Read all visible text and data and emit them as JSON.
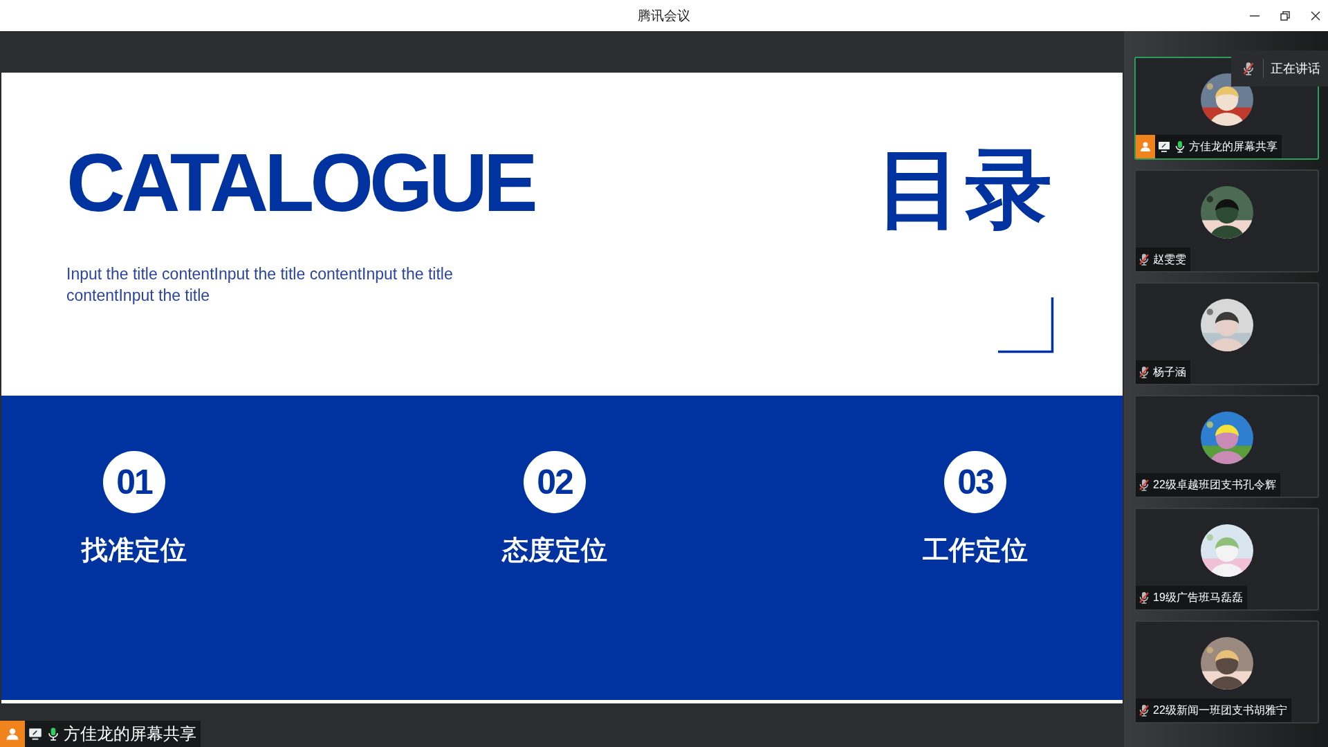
{
  "window": {
    "title": "腾讯会议"
  },
  "slide": {
    "title": "CATALOGUE",
    "title_cn": "目录",
    "subtitle": "Input the title contentInput the title contentInput the title contentInput the title",
    "items": [
      {
        "number": "01",
        "label": "找准定位"
      },
      {
        "number": "02",
        "label": "态度定位"
      },
      {
        "number": "03",
        "label": "工作定位"
      }
    ]
  },
  "share_label": {
    "host": true,
    "sharing": true,
    "muted": false,
    "text": "方佳龙的屏幕共享"
  },
  "speaking_popup": {
    "muted": true,
    "text": "正在讲话"
  },
  "participants": [
    {
      "name": "方佳龙的屏幕共享",
      "speaking": true,
      "host": true,
      "sharing": true,
      "muted": false
    },
    {
      "name": "赵雯雯",
      "speaking": false,
      "host": false,
      "sharing": false,
      "muted": true
    },
    {
      "name": "杨子涵",
      "speaking": false,
      "host": false,
      "sharing": false,
      "muted": true
    },
    {
      "name": "22级卓越班团支书孔令辉",
      "speaking": false,
      "host": false,
      "sharing": false,
      "muted": true
    },
    {
      "name": "19级广告班马磊磊",
      "speaking": false,
      "host": false,
      "sharing": false,
      "muted": true
    },
    {
      "name": "22级新闻一班团支书胡雅宁",
      "speaking": false,
      "host": false,
      "sharing": false,
      "muted": true
    }
  ]
}
